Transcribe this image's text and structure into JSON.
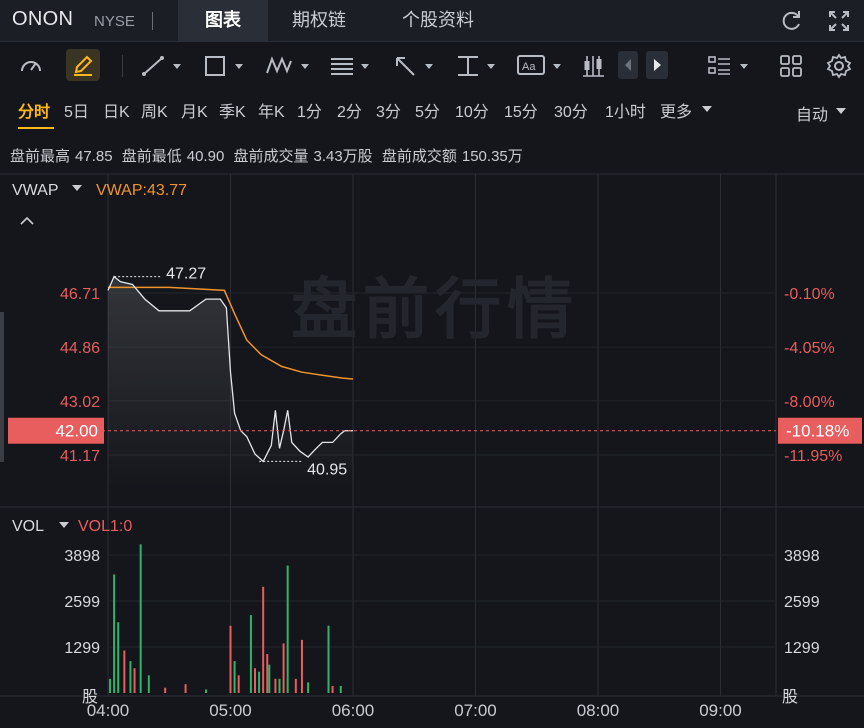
{
  "header": {
    "symbol": "ONON",
    "exchange": "NYSE",
    "tabs": [
      "图表",
      "期权链",
      "个股资料"
    ]
  },
  "icons": [
    "refresh-icon",
    "fullscreen-icon",
    "gauge-icon",
    "pen-icon",
    "trend-line-icon",
    "rectangle-icon",
    "pattern-icon",
    "fib-icon",
    "arrow-icon",
    "measure-icon",
    "text-icon",
    "candle-icon",
    "prev-icon",
    "next-icon",
    "layout-list-icon",
    "grid-icon",
    "gear-icon"
  ],
  "timeframes": [
    "分时",
    "5日",
    "日K",
    "周K",
    "月K",
    "季K",
    "年K",
    "1分",
    "2分",
    "3分",
    "5分",
    "10分",
    "15分",
    "30分",
    "1小时",
    "更多"
  ],
  "auto_label": "自动",
  "stats": {
    "high_label": "盘前最高",
    "high": "47.85",
    "low_label": "盘前最低",
    "low": "40.90",
    "vol_label": "盘前成交量",
    "vol": "3.43万股",
    "amt_label": "盘前成交额",
    "amt": "150.35万"
  },
  "chart_data": [
    {
      "type": "line",
      "panel": "price",
      "indicator_label": "VWAP",
      "vwap_label": "VWAP:43.77",
      "watermark": "盘前行情",
      "y_ticks_left": [
        "46.71",
        "44.86",
        "43.02",
        "41.17"
      ],
      "y_ticks_right": [
        "-0.10%",
        "-4.05%",
        "-8.00%",
        "-11.95%"
      ],
      "current_price": "42.00",
      "current_pct": "-10.18%",
      "max_label": "47.27",
      "min_label": "40.95",
      "x_ticks": [
        "04:00",
        "05:00",
        "06:00",
        "07:00",
        "08:00",
        "09:00"
      ],
      "ylim": [
        39.9,
        48.8
      ],
      "price_series": [
        [
          "04:00",
          46.8
        ],
        [
          "04:03",
          47.27
        ],
        [
          "04:06",
          47.1
        ],
        [
          "04:12",
          47.0
        ],
        [
          "04:18",
          46.5
        ],
        [
          "04:25",
          46.1
        ],
        [
          "04:40",
          46.1
        ],
        [
          "04:48",
          46.5
        ],
        [
          "04:55",
          46.5
        ],
        [
          "04:58",
          46.2
        ],
        [
          "05:00",
          44.0
        ],
        [
          "05:02",
          42.6
        ],
        [
          "05:05",
          42.0
        ],
        [
          "05:08",
          41.8
        ],
        [
          "05:12",
          41.2
        ],
        [
          "05:16",
          40.95
        ],
        [
          "05:20",
          41.5
        ],
        [
          "05:22",
          42.7
        ],
        [
          "05:24",
          41.4
        ],
        [
          "05:26",
          42.0
        ],
        [
          "05:28",
          42.7
        ],
        [
          "05:30",
          41.6
        ],
        [
          "05:34",
          41.3
        ],
        [
          "05:38",
          41.1
        ],
        [
          "05:42",
          41.4
        ],
        [
          "05:45",
          41.6
        ],
        [
          "05:50",
          41.6
        ],
        [
          "05:54",
          41.9
        ],
        [
          "05:56",
          42.0
        ],
        [
          "06:00",
          42.0
        ]
      ],
      "vwap_series": [
        [
          "04:00",
          46.9
        ],
        [
          "04:30",
          46.9
        ],
        [
          "04:57",
          46.8
        ],
        [
          "05:02",
          46.0
        ],
        [
          "05:08",
          45.1
        ],
        [
          "05:15",
          44.6
        ],
        [
          "05:25",
          44.2
        ],
        [
          "05:35",
          44.0
        ],
        [
          "05:45",
          43.9
        ],
        [
          "05:55",
          43.8
        ],
        [
          "06:00",
          43.77
        ]
      ]
    },
    {
      "type": "bar",
      "panel": "volume",
      "indicator_label": "VOL",
      "series_label": "VOL1:0",
      "y_ticks": [
        "3898",
        "2599",
        "1299"
      ],
      "unit": "股",
      "bars": [
        [
          1,
          400,
          "g"
        ],
        [
          3,
          3350,
          "g"
        ],
        [
          5,
          2000,
          "g"
        ],
        [
          8,
          1200,
          "r"
        ],
        [
          11,
          900,
          "g"
        ],
        [
          13,
          700,
          "r"
        ],
        [
          16,
          4200,
          "g"
        ],
        [
          20,
          500,
          "g"
        ],
        [
          28,
          150,
          "r"
        ],
        [
          38,
          250,
          "r"
        ],
        [
          48,
          100,
          "g"
        ],
        [
          60,
          1900,
          "r"
        ],
        [
          62,
          900,
          "g"
        ],
        [
          64,
          500,
          "r"
        ],
        [
          70,
          2200,
          "g"
        ],
        [
          72,
          700,
          "r"
        ],
        [
          74,
          600,
          "g"
        ],
        [
          76,
          3000,
          "r"
        ],
        [
          78,
          1100,
          "r"
        ],
        [
          79,
          800,
          "g"
        ],
        [
          82,
          400,
          "r"
        ],
        [
          84,
          400,
          "g"
        ],
        [
          86,
          1400,
          "r"
        ],
        [
          88,
          3600,
          "g"
        ],
        [
          92,
          400,
          "r"
        ],
        [
          95,
          1500,
          "r"
        ],
        [
          98,
          300,
          "g"
        ],
        [
          108,
          1900,
          "g"
        ],
        [
          110,
          200,
          "r"
        ],
        [
          114,
          200,
          "g"
        ]
      ]
    }
  ]
}
